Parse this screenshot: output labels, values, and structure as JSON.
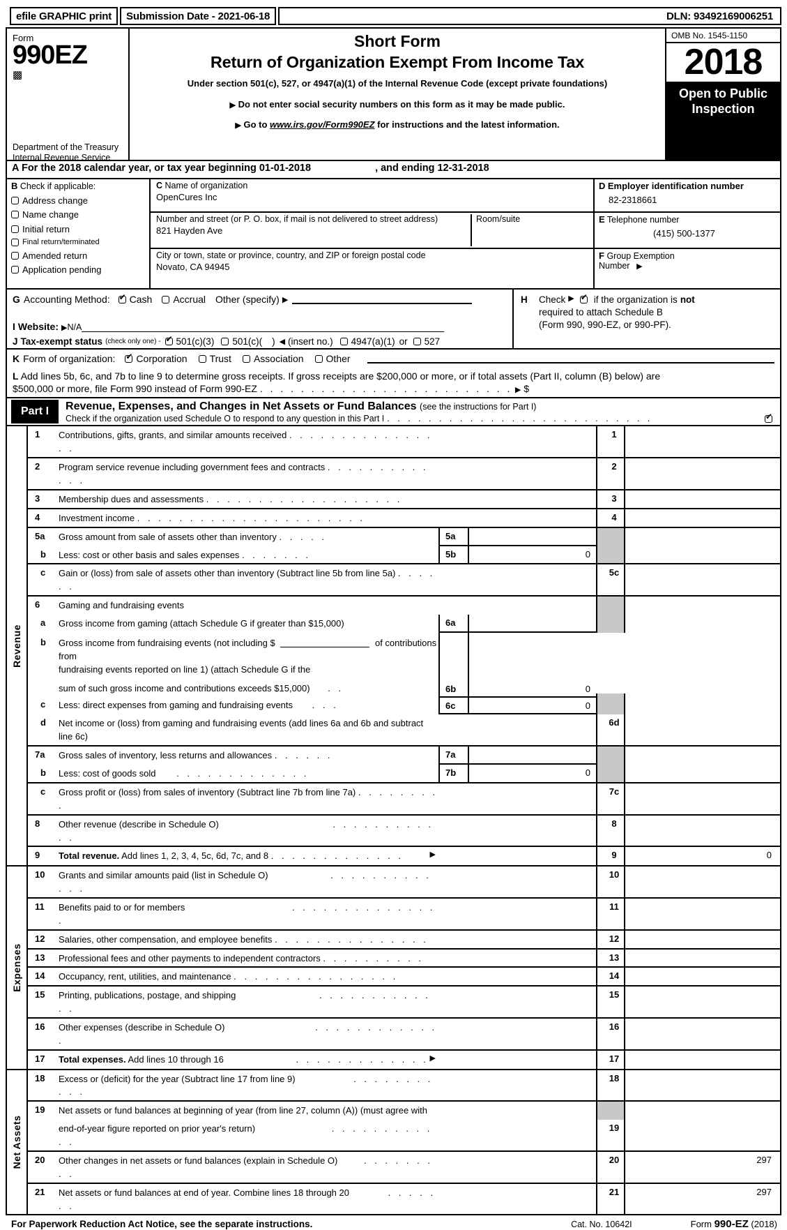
{
  "efile": {
    "print_label": "efile GRAPHIC print",
    "submission_date": "Submission Date - 2021-06-18",
    "dln": "DLN: 93492169006251"
  },
  "masthead": {
    "form_label": "Form",
    "form_number": "990EZ",
    "department": "Department of the Treasury Internal Revenue Service",
    "title_short": "Short Form",
    "title_main": "Return of Organization Exempt From Income Tax",
    "subtitle": "Under section 501(c), 527, or 4947(a)(1) of the Internal Revenue Code (except private foundations)",
    "bullet1": "Do not enter social security numbers on this form as it may be made public.",
    "bullet2_prefix": "Go to",
    "bullet2_link": "www.irs.gov/Form990EZ",
    "bullet2_suffix": "for instructions and the latest information.",
    "omb": "OMB No. 1545-1150",
    "year": "2018",
    "open_to_public": "Open to Public Inspection"
  },
  "lineA": {
    "key": "A",
    "text": "For the 2018 calendar year, or tax year beginning 01-01-2018",
    "ending": ", and ending 12-31-2018"
  },
  "boxB": {
    "key": "B",
    "heading": "Check if applicable:",
    "items": [
      {
        "label": "Address change",
        "checked": false
      },
      {
        "label": "Name change",
        "checked": false
      },
      {
        "label": "Initial return",
        "checked": false
      },
      {
        "label": "Final return/terminated",
        "checked": false
      },
      {
        "label": "Amended return",
        "checked": false
      },
      {
        "label": "Application pending",
        "checked": false
      }
    ]
  },
  "boxC": {
    "key": "C",
    "name_label": "Name of organization",
    "org_name": "OpenCures Inc",
    "street_label": "Number and street (or P. O. box, if mail is not delivered to street address)",
    "street_value": "821 Hayden Ave",
    "room_label": "Room/suite",
    "room_value": "",
    "city_label": "City or town, state or province, country, and ZIP or foreign postal code",
    "city_value": "Novato, CA   94945"
  },
  "boxD": {
    "key": "D",
    "label": "Employer identification number",
    "value": "82-2318661"
  },
  "boxE": {
    "key": "E",
    "label": "Telephone number",
    "value": "(415) 500-1377"
  },
  "boxF": {
    "key": "F",
    "label": "Group Exemption",
    "label2": "Number"
  },
  "boxG": {
    "key": "G",
    "label": "Accounting Method:",
    "cash": "Cash",
    "cash_checked": true,
    "accrual": "Accrual",
    "accrual_checked": false,
    "other": "Other (specify)",
    "other_value": ""
  },
  "boxH": {
    "key": "H",
    "check_label": "Check",
    "checked": true,
    "text1_a": "if the organization is",
    "text1_b": "not",
    "text2": "required to attach Schedule B",
    "text3": "(Form 990, 990-EZ, or 990-PF)."
  },
  "boxI": {
    "key": "I",
    "label": "Website:",
    "value": "N/A"
  },
  "boxJ": {
    "key": "J",
    "label": "Tax-exempt status",
    "note": "(check only one) -",
    "opt1": "501(c)(3)",
    "opt1_checked": true,
    "opt2a": "501(c)(",
    "opt2b": ")",
    "opt2_checked": false,
    "insert": "(insert no.)",
    "opt3": "4947(a)(1)",
    "opt3_checked": false,
    "or": "or",
    "opt4": "527",
    "opt4_checked": false
  },
  "boxK": {
    "key": "K",
    "label": "Form of organization:",
    "options": [
      {
        "label": "Corporation",
        "checked": true
      },
      {
        "label": "Trust",
        "checked": false
      },
      {
        "label": "Association",
        "checked": false
      },
      {
        "label": "Other",
        "checked": false
      }
    ]
  },
  "boxL": {
    "key": "L",
    "text1": "Add lines 5b, 6c, and 7b to line 9 to determine gross receipts. If gross receipts are $200,000 or more, or if total assets (Part II, column (B) below) are",
    "text2": "$500,000 or more, file Form 990 instead of Form 990-EZ",
    "dollar": "$"
  },
  "part1": {
    "tag": "Part I",
    "title": "Revenue, Expenses, and Changes in Net Assets or Fund Balances",
    "title_note": "(see the instructions for Part I)",
    "check_text": "Check if the organization used Schedule O to respond to any question in this Part I",
    "checked": true
  },
  "sections": [
    {
      "vlabel": "Revenue",
      "rows": [
        {
          "no": "1",
          "desc": "Contributions, gifts, grants, and similar amounts received",
          "dots": ". . . . . . . . . . . . . . . .",
          "rno": "1",
          "rval": "",
          "rgray": false,
          "rnogray": false
        },
        {
          "no": "2",
          "desc": "Program service revenue including government fees and contracts",
          "dots": ". . . . . . . . . . . . .",
          "rno": "2",
          "rval": "",
          "rgray": false,
          "rnogray": false
        },
        {
          "no": "3",
          "desc": "Membership dues and assessments",
          "dots": ". . . . . . . . . . . . . . . . . . .",
          "rno": "3",
          "rval": "",
          "rgray": false,
          "rnogray": false
        },
        {
          "no": "4",
          "desc": "Investment income",
          "dots": ". . . . . . . . . . . . . . . . . . . . . .",
          "rno": "4",
          "rval": "",
          "rgray": false,
          "rnogray": false
        },
        {
          "no": "5a",
          "desc": "Gross amount from sale of assets other than inventory",
          "dots": ". . . . .",
          "mno": "5a",
          "mval": "",
          "rno": "",
          "rval": "",
          "rgray": true,
          "rnogray": true
        },
        {
          "no": "b",
          "indent": true,
          "desc": "Less: cost or other basis and sales expenses",
          "dots": ". . . . . . .",
          "mno": "5b",
          "mval": "0",
          "rno": "",
          "rval": "",
          "rgray": true,
          "rnogray": true
        },
        {
          "no": "c",
          "indent": true,
          "desc": "Gain or (loss) from sale of assets other than inventory (Subtract line 5b from line 5a)",
          "dots": ". . . . . .",
          "rno": "5c",
          "rval": "",
          "rgray": false,
          "rnogray": false
        },
        {
          "no": "6",
          "desc": "Gaming and fundraising events",
          "dots": "",
          "rno": "",
          "rval": "",
          "rgray": true,
          "rnogray": true
        },
        {
          "no": "a",
          "indent": true,
          "desc": "Gross income from gaming (attach Schedule G if greater than $15,000)",
          "dots": "",
          "mno": "6a",
          "mval": "",
          "rno": "",
          "rval": "",
          "rgray": true,
          "rnogray": true
        },
        {
          "no": "b",
          "indent": true,
          "desc": "FUNDRAISING_SPECIAL",
          "dots": "",
          "mno": "6b",
          "mval": "0",
          "rno": "",
          "rval": "",
          "rgray": true,
          "rnogray": true
        },
        {
          "no": "c",
          "indent": true,
          "desc": "Less: direct expenses from gaming and fundraising events",
          "dots": ". . .",
          "mno": "6c",
          "mval": "0",
          "rno": "",
          "rval": "",
          "rgray": true,
          "rnogray": true
        },
        {
          "no": "d",
          "indent": true,
          "desc": "Net income or (loss) from gaming and fundraising events (add lines 6a and 6b and subtract line 6c)",
          "dots": "",
          "rno": "6d",
          "rval": "",
          "rgray": false,
          "rnogray": false
        },
        {
          "no": "7a",
          "desc": "Gross sales of inventory, less returns and allowances",
          "dots": ". . . . . .",
          "mno": "7a",
          "mval": "",
          "rno": "",
          "rval": "",
          "rgray": true,
          "rnogray": true
        },
        {
          "no": "b",
          "indent": true,
          "desc": "Less: cost of goods sold",
          "dots": ". . . . . . . . . . . . .",
          "mno": "7b",
          "mval": "0",
          "rno": "",
          "rval": "",
          "rgray": true,
          "rnogray": true
        },
        {
          "no": "c",
          "indent": true,
          "desc": "Gross profit or (loss) from sales of inventory (Subtract line 7b from line 7a)",
          "dots": ". . . . . . . . .",
          "rno": "7c",
          "rval": "",
          "rgray": false,
          "rnogray": false
        },
        {
          "no": "8",
          "desc": "Other revenue (describe in Schedule O)",
          "dots": ". . . . . . . . . . . .",
          "rno": "8",
          "rval": "",
          "rgray": false,
          "rnogray": false
        },
        {
          "no": "9",
          "desc_bold": "Total revenue.",
          "desc": " Add lines 1, 2, 3, 4, 5c, 6d, 7c, and 8",
          "dots": ". . . . . . . . . . . . .",
          "arrow": true,
          "rno": "9",
          "rval": "0",
          "rgray": false,
          "rnogray": false
        }
      ]
    },
    {
      "vlabel": "Expenses",
      "rows": [
        {
          "no": "10",
          "desc": "Grants and similar amounts paid (list in Schedule O)",
          "dots": ". . . . . . . . . . . . .",
          "rno": "10",
          "rval": "",
          "rgray": false,
          "rnogray": false
        },
        {
          "no": "11",
          "desc": "Benefits paid to or for members",
          "dots": ". . . . . . . . . . . . . . .",
          "rno": "11",
          "rval": "",
          "rgray": false,
          "rnogray": false
        },
        {
          "no": "12",
          "desc": "Salaries, other compensation, and employee benefits",
          "dots": ". . . . . . . . . . . . . . .",
          "rno": "12",
          "rval": "",
          "rgray": false,
          "rnogray": false
        },
        {
          "no": "13",
          "desc": "Professional fees and other payments to independent contractors",
          "dots": ". . . . . . . . . .",
          "rno": "13",
          "rval": "",
          "rgray": false,
          "rnogray": false
        },
        {
          "no": "14",
          "desc": "Occupancy, rent, utilities, and maintenance",
          "dots": ". . . . . . . . . . . . . . . .",
          "rno": "14",
          "rval": "",
          "rgray": false,
          "rnogray": false
        },
        {
          "no": "15",
          "desc": "Printing, publications, postage, and shipping",
          "dots": ". . . . . . . . . . . . .",
          "rno": "15",
          "rval": "",
          "rgray": false,
          "rnogray": false
        },
        {
          "no": "16",
          "desc": "Other expenses (describe in Schedule O)",
          "dots": ". . . . . . . . . . . . .",
          "rno": "16",
          "rval": "",
          "rgray": false,
          "rnogray": false
        },
        {
          "no": "17",
          "desc_bold": "Total expenses.",
          "desc": " Add lines 10 through 16",
          "dots": ". . . . . . . . . . . . .",
          "arrow": true,
          "rno": "17",
          "rval": "",
          "rgray": false,
          "rnogray": false
        }
      ]
    },
    {
      "vlabel": "Net Assets",
      "rows": [
        {
          "no": "18",
          "desc": "Excess or (deficit) for the year (Subtract line 17 from line 9)",
          "dots": ". . . . . . . . . . .",
          "rno": "18",
          "rval": "",
          "rgray": false,
          "rnogray": false
        },
        {
          "no": "19",
          "desc": "Net assets or fund balances at beginning of year (from line 27, column (A)) (must agree with",
          "dots": "",
          "rno": "",
          "rval": "",
          "rgray": false,
          "rnogray": true
        },
        {
          "no": "",
          "indent": true,
          "desc": "end-of-year figure reported on prior year's return)",
          "dots": ". . . . . . . . . . . .",
          "rno": "19",
          "rval": "",
          "rgray": false,
          "rnogray": false
        },
        {
          "no": "20",
          "desc": "Other changes in net assets or fund balances (explain in Schedule O)",
          "dots": ". . . . . . . . .",
          "rno": "20",
          "rval": "297",
          "rgray": false,
          "rnogray": false
        },
        {
          "no": "21",
          "desc": "Net assets or fund balances at end of year. Combine lines 18 through 20",
          "dots": ". . . . . . .",
          "rno": "21",
          "rval": "297",
          "rgray": false,
          "rnogray": false
        }
      ]
    }
  ],
  "fundraising_b": {
    "p1": "Gross income from fundraising events (not including $",
    "p2": "of contributions from",
    "p3": "fundraising events reported on line 1) (attach Schedule G if the",
    "p4": "sum of such gross income and contributions exceeds $15,000)",
    "dots": ". ."
  },
  "footer": {
    "left": "For Paperwork Reduction Act Notice, see the separate instructions.",
    "cat": "Cat. No. 10642I",
    "right_prefix": "Form ",
    "right_bold": "990-EZ",
    "right_suffix": " (2018)"
  }
}
